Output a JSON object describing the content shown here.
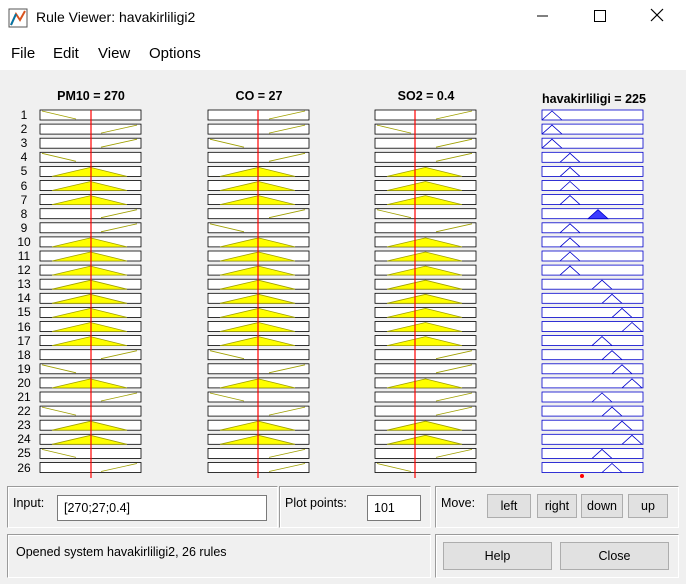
{
  "window": {
    "title": "Rule Viewer: havakirliligi2",
    "minimize_icon": "minimize-icon",
    "maximize_icon": "maximize-icon",
    "close_icon": "close-icon"
  },
  "menu": [
    "File",
    "Edit",
    "View",
    "Options"
  ],
  "columns": {
    "pm10": "PM10 = 270",
    "co": "CO = 27",
    "so2": "SO2 = 0.4",
    "output": "havakirliligi = 225"
  },
  "rule_numbers": [
    "1",
    "2",
    "3",
    "4",
    "5",
    "6",
    "7",
    "8",
    "9",
    "10",
    "11",
    "12",
    "13",
    "14",
    "15",
    "16",
    "17",
    "18",
    "19",
    "20",
    "21",
    "22",
    "23",
    "24",
    "25",
    "26"
  ],
  "input_panel": {
    "label": "Input:",
    "value": "[270;27;0.4]",
    "plot_points_label": "Plot points:",
    "plot_points_value": "101"
  },
  "move_panel": {
    "label": "Move:",
    "left": "left",
    "right": "right",
    "down": "down",
    "up": "up"
  },
  "status": {
    "text": "Opened system havakirliligi2, 26 rules"
  },
  "buttons": {
    "help": "Help",
    "close": "Close"
  },
  "colors": {
    "input_fill": "#ffff00",
    "output_fill": "#3c3cff",
    "output_line": "#0000cc",
    "input_line": "#a0a000",
    "indicator": "#ff0000"
  },
  "mf_codes": {
    "pm10": "0000111001111111100100110000",
    "co": "0000111001111111100100110000",
    "so2": "0000111001111111100100110000",
    "output": "0000111001111111100100110000"
  }
}
